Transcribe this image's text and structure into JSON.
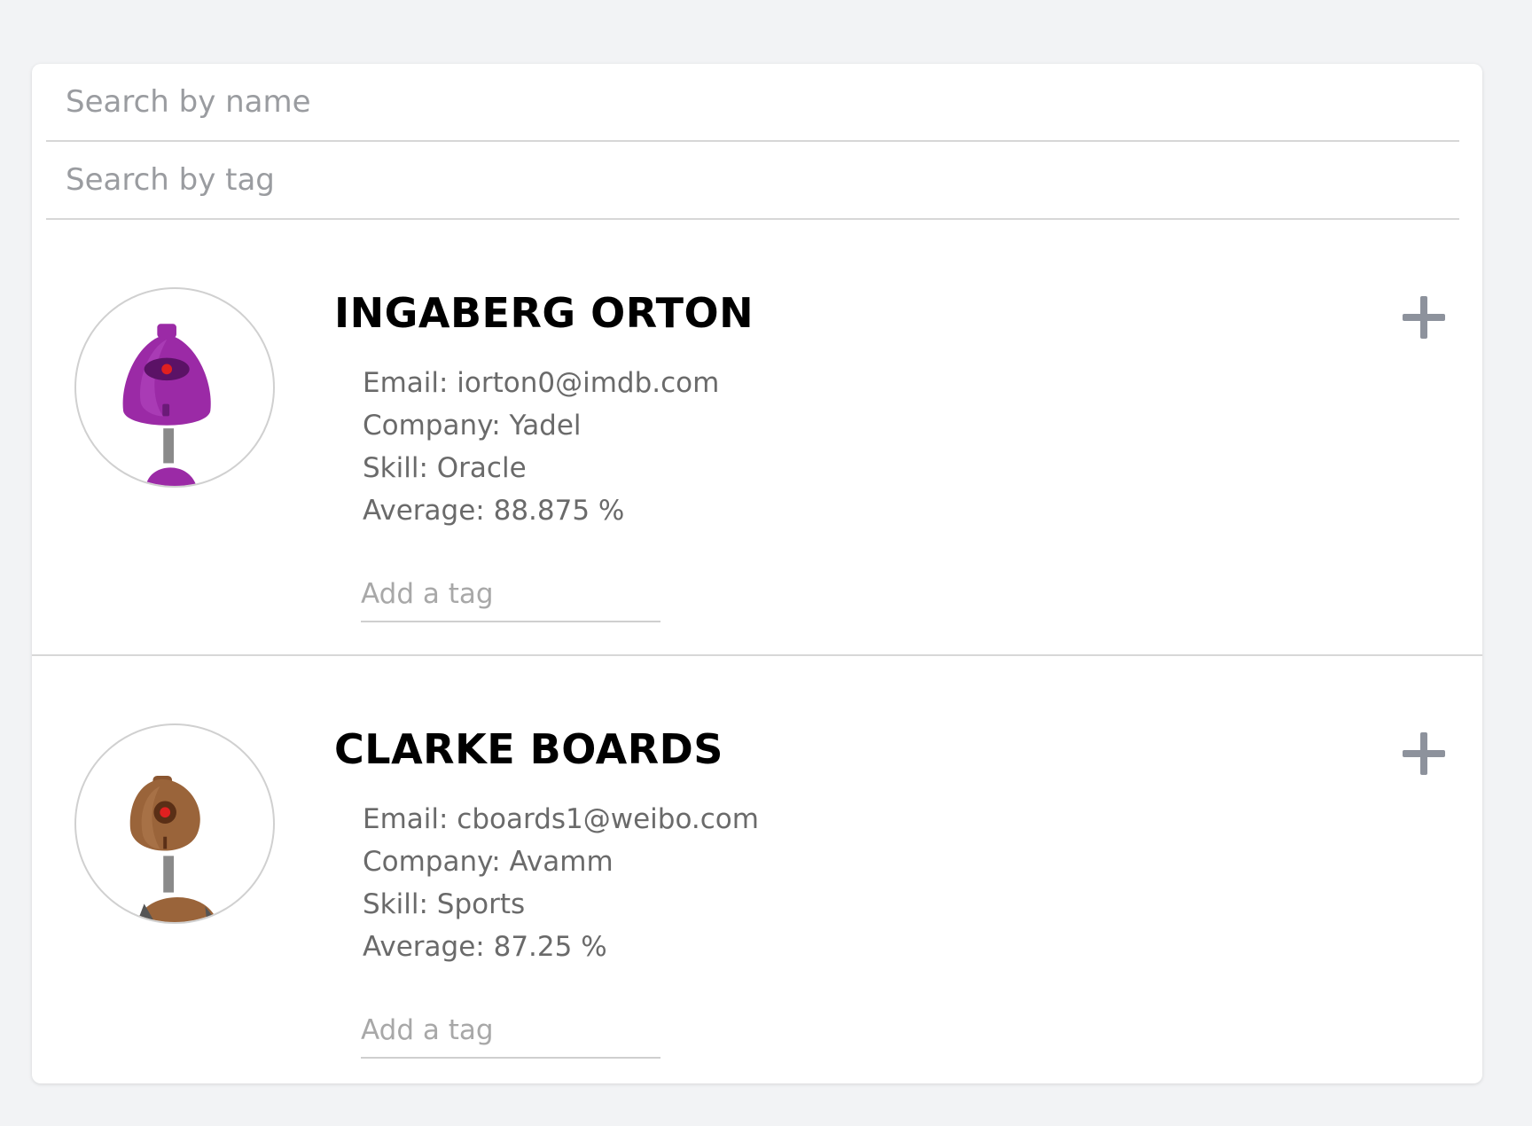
{
  "search": {
    "name_placeholder": "Search by name",
    "tag_placeholder": "Search by tag"
  },
  "students": [
    {
      "name": "INGABERG ORTON",
      "email": "Email: iorton0@imdb.com",
      "company": "Company: Yadel",
      "skill": "Skill: Oracle",
      "average": "Average: 88.875 %",
      "tag_placeholder": "Add a tag",
      "avatar_icon": "purple-robot-icon",
      "avatar_color": "#9b2aa6"
    },
    {
      "name": "CLARKE BOARDS",
      "email": "Email: cboards1@weibo.com",
      "company": "Company: Avamm",
      "skill": "Skill: Sports",
      "average": "Average: 87.25 %",
      "tag_placeholder": "Add a tag",
      "avatar_icon": "brown-robot-icon",
      "avatar_color": "#9a643a"
    }
  ],
  "colors": {
    "background": "#f2f3f5",
    "card": "#ffffff",
    "plus_icon": "#8d929c"
  }
}
